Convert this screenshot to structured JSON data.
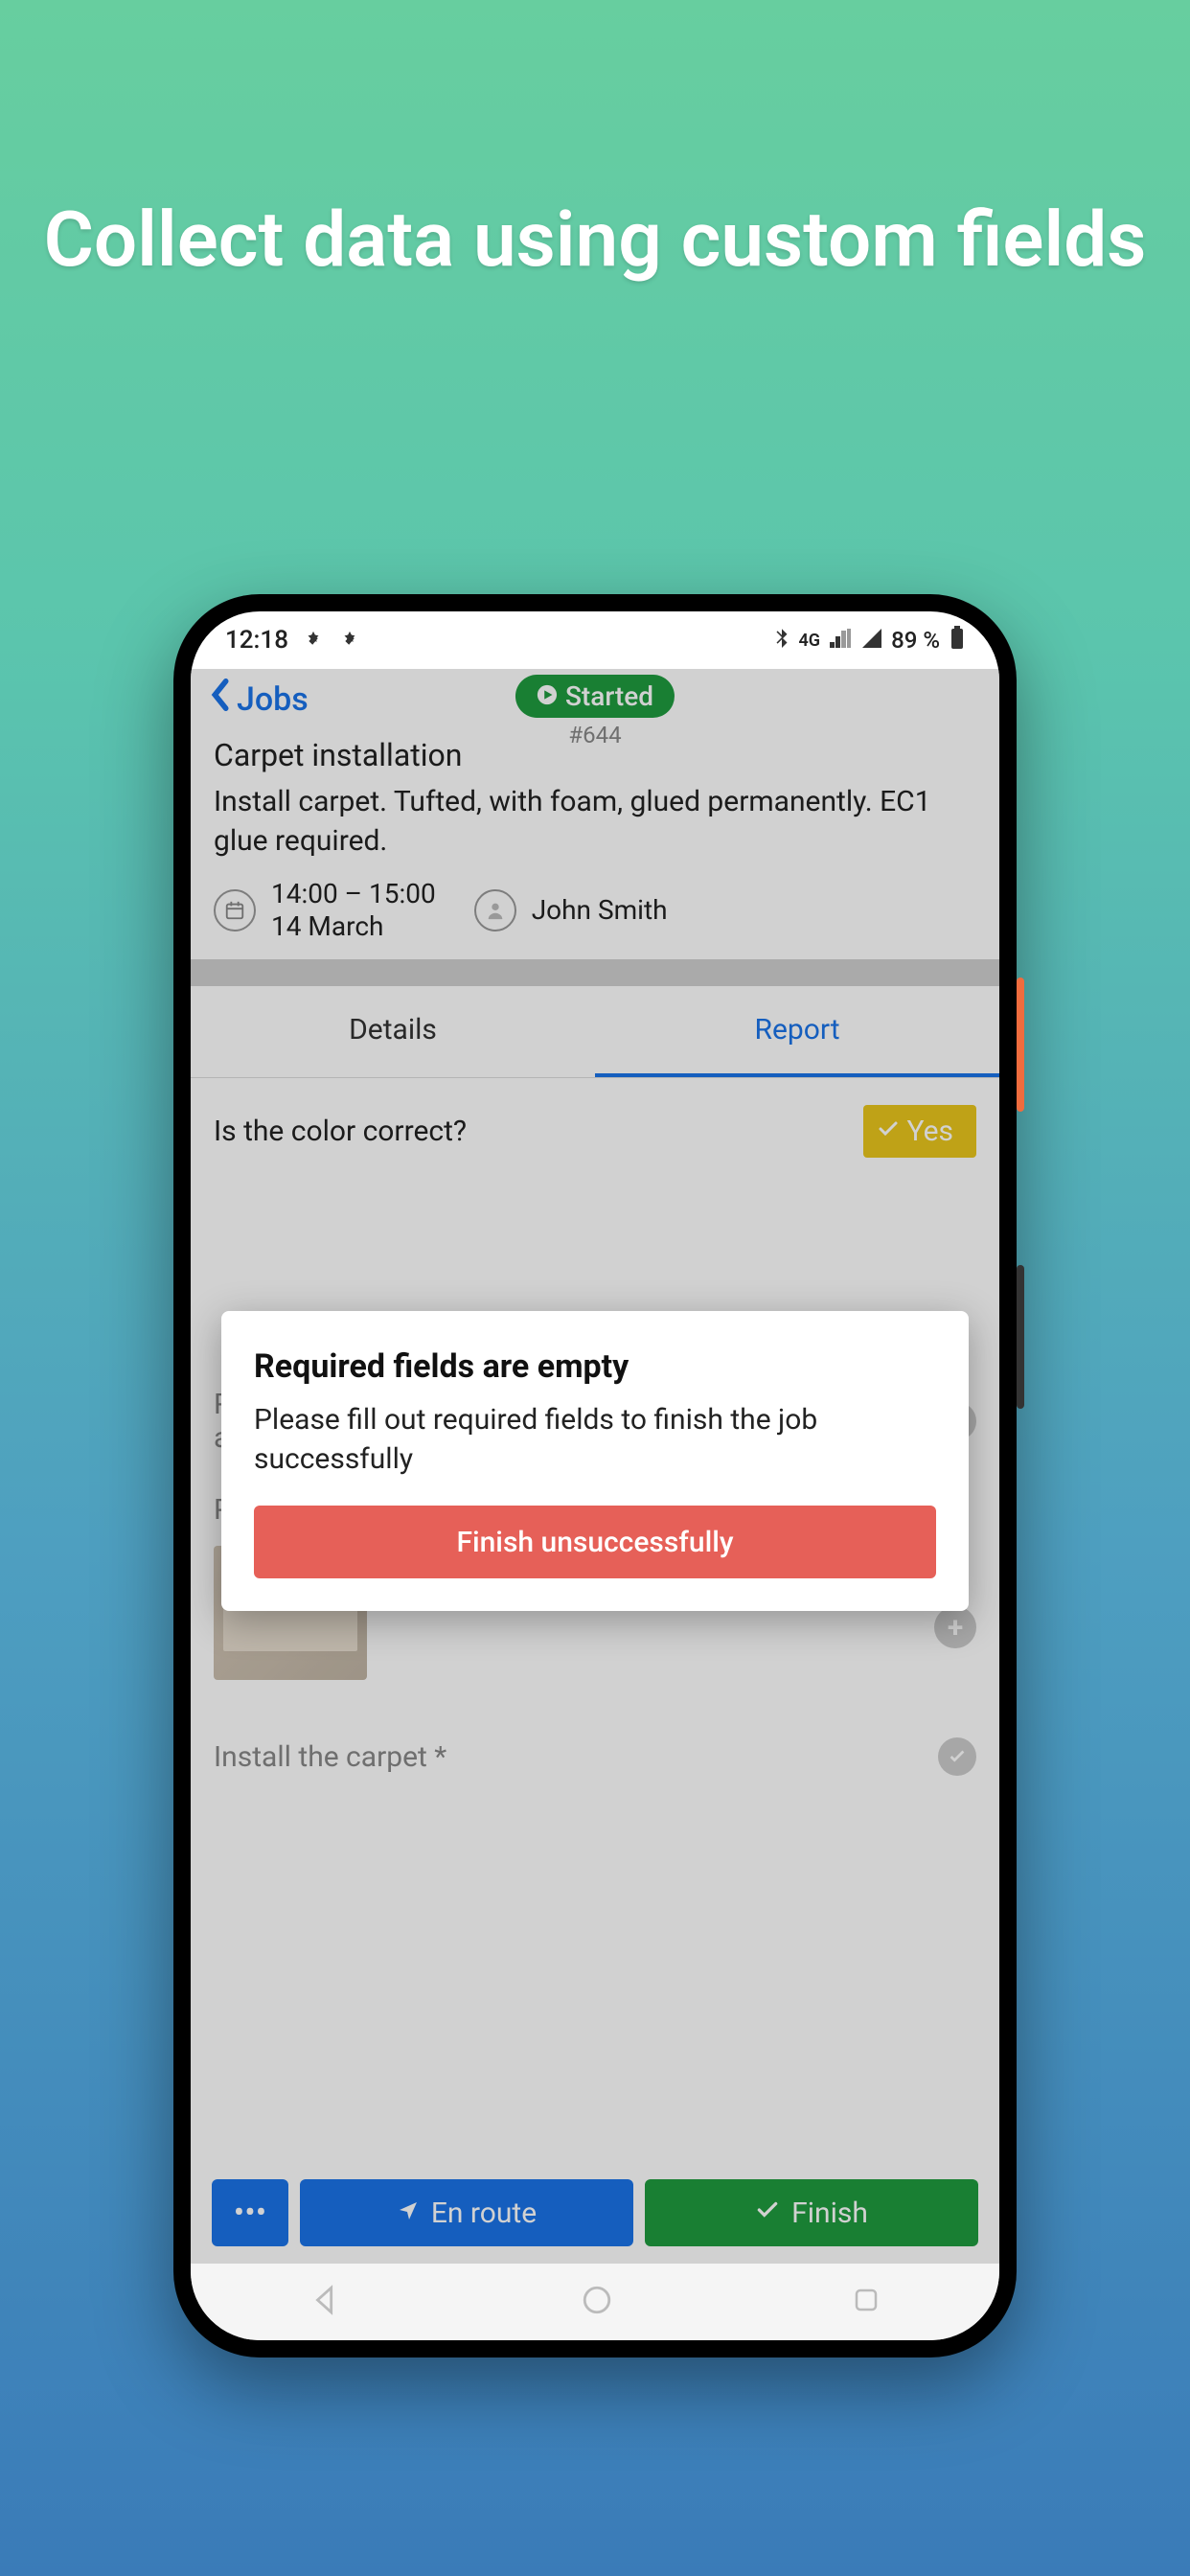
{
  "promo": {
    "headline": "Collect data using custom fields"
  },
  "status_bar": {
    "time": "12:18",
    "battery": "89 %",
    "network": "4G"
  },
  "header": {
    "back_label": "Jobs",
    "status_badge": "Started",
    "job_number": "#644"
  },
  "job": {
    "title": "Carpet installation",
    "description": "Install carpet. Tufted, with foam, glued permanently. EC1 glue required.",
    "time": "14:00 – 15:00",
    "date": "14 March",
    "assignee": "John Smith"
  },
  "tabs": {
    "details": "Details",
    "report": "Report",
    "active": "report"
  },
  "report": {
    "color_question": "Is the color correct?",
    "color_answer": "Yes",
    "remove_label": "Remove any installed equipment or appliances *",
    "prepared_label": "Prepared site *",
    "install_label": "Install the carpet *"
  },
  "modal": {
    "title": "Required fields are empty",
    "message": "Please fill out required fields to finish the job successfully",
    "button": "Finish unsuccessfully"
  },
  "actions": {
    "more": "•••",
    "en_route": "En route",
    "finish": "Finish"
  }
}
